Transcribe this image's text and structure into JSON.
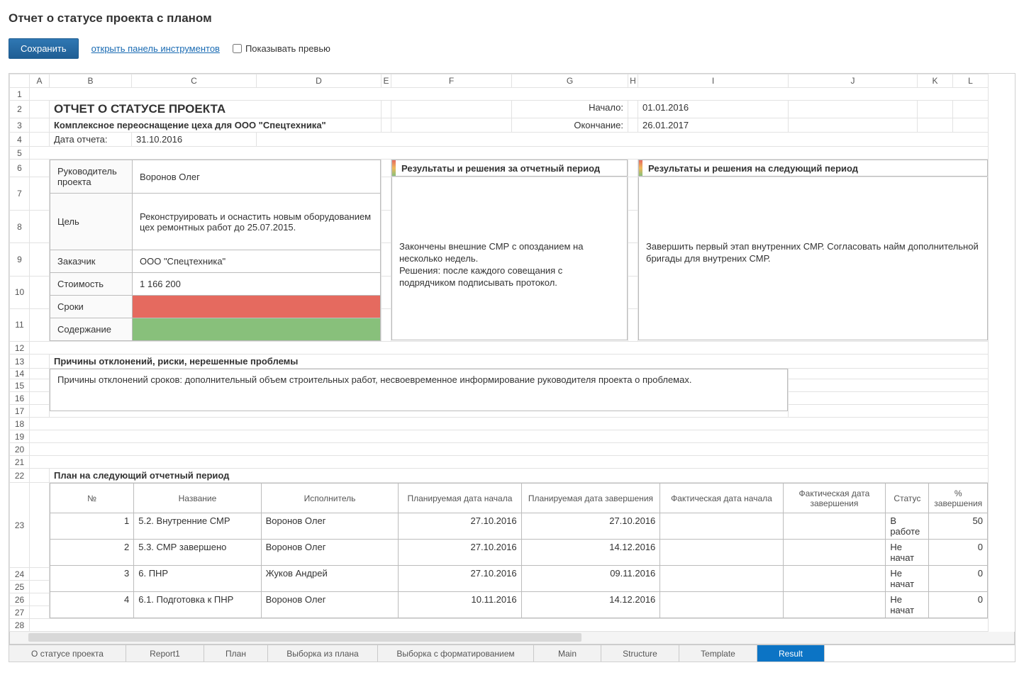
{
  "page_title": "Отчет о статусе проекта с планом",
  "toolbar": {
    "save": "Сохранить",
    "open_tools": "открыть панель инструментов",
    "show_preview": "Показывать превью"
  },
  "columns": {
    "A": "A",
    "B": "B",
    "C": "C",
    "D": "D",
    "E": "E",
    "F": "F",
    "G": "G",
    "H": "H",
    "I": "I",
    "J": "J",
    "K": "K",
    "L": "L"
  },
  "report": {
    "title": "ОТЧЕТ О СТАТУСЕ ПРОЕКТА",
    "subtitle": "Комплексное переоснащение цеха для ООО \"Спецтехника\"",
    "start_lbl": "Начало:",
    "start_val": "01.01.2016",
    "end_lbl": "Окончание:",
    "end_val": "26.01.2017",
    "report_date_lbl": "Дата отчета:",
    "report_date_val": "31.10.2016"
  },
  "info": {
    "manager_lbl": "Руководитель проекта",
    "manager_val": "Воронов Олег",
    "goal_lbl": "Цель",
    "goal_val": "Реконструировать и оснастить новым оборудованием цех ремонтных работ до 25.07.2015.",
    "customer_lbl": "Заказчик",
    "customer_val": "ООО \"Спецтехника\"",
    "cost_lbl": "Стоимость",
    "cost_val": "1 166 200",
    "deadline_lbl": "Сроки",
    "scope_lbl": "Содержание"
  },
  "panels": {
    "results_period_title": "Результаты и решения за отчетный период",
    "results_period_text": "Закончены внешние СМР с опозданием на несколько недель.\nРешения: после каждого совещания с подрядчиком подписывать протокол.",
    "results_next_title": "Результаты и решения на следующий период",
    "results_next_text": "Завершить первый этап внутренних СМР. Согласовать найм дополнительной бригады для внутрених СМР."
  },
  "deviation": {
    "title": "Причины отклонений, риски, нерешенные проблемы",
    "text": "Причины отклонений сроков: дополнительный объем строительных работ, несвоевременное информирование руководителя проекта о проблемах."
  },
  "plan": {
    "title": "План на следующий отчетный период",
    "headers": {
      "num": "№",
      "name": "Название",
      "exec": "Исполнитель",
      "plan_start": "Планируемая дата начала",
      "plan_end": "Планируемая дата завершения",
      "fact_start": "Фактическая дата начала",
      "fact_end": "Фактическая дата завершения",
      "status": "Статус",
      "pct": "% завершения"
    },
    "rows": [
      {
        "num": "1",
        "name": "5.2. Внутренние СМР",
        "exec": "Воронов Олег",
        "ps": "27.10.2016",
        "pe": "27.10.2016",
        "fs": "",
        "fe": "",
        "status": "В работе",
        "pct": "50"
      },
      {
        "num": "2",
        "name": "5.3. СМР завершено",
        "exec": "Воронов Олег",
        "ps": "27.10.2016",
        "pe": "14.12.2016",
        "fs": "",
        "fe": "",
        "status": "Не начат",
        "pct": "0"
      },
      {
        "num": "3",
        "name": "6. ПНР",
        "exec": "Жуков Андрей",
        "ps": "27.10.2016",
        "pe": "09.11.2016",
        "fs": "",
        "fe": "",
        "status": "Не начат",
        "pct": "0"
      },
      {
        "num": "4",
        "name": "6.1. Подготовка к ПНР",
        "exec": "Воронов Олег",
        "ps": "10.11.2016",
        "pe": "14.12.2016",
        "fs": "",
        "fe": "",
        "status": "Не начат",
        "pct": "0"
      }
    ]
  },
  "tabs": [
    "О статусе проекта",
    "Report1",
    "План",
    "Выборка из плана",
    "Выборка с форматированием",
    "Main",
    "Structure",
    "Template",
    "Result"
  ]
}
